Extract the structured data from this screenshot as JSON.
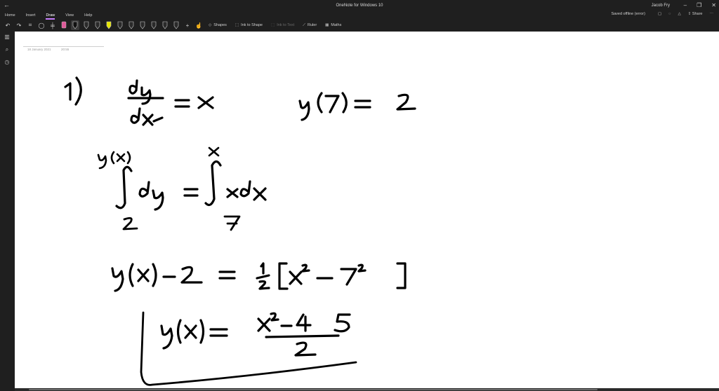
{
  "window": {
    "title": "OneNote for Windows 10",
    "user": "Jacob Fry"
  },
  "ribbon": {
    "tabs": [
      "Home",
      "Insert",
      "Draw",
      "View",
      "Help"
    ],
    "active_tab": "Draw",
    "status": "Saved offline (error)",
    "share_label": "Share"
  },
  "toolbar": {
    "shapes_label": "Shapes",
    "ink_to_shape_label": "Ink to Shape",
    "ink_to_text_label": "Ink to Text",
    "ruler_label": "Ruler",
    "maths_label": "Maths",
    "pen_colors": [
      "#111111",
      "#111111",
      "#2a2a2a",
      "#2a2a2a",
      "#e6e600",
      "#2a2a2a",
      "#2a2a2a",
      "#2a2a2a",
      "#2a2a2a",
      "#2a2a2a"
    ]
  },
  "page": {
    "date": "18 January 2021",
    "time": "20:55"
  },
  "colors": {
    "accent": "#c77dff",
    "ink": "#000000"
  }
}
